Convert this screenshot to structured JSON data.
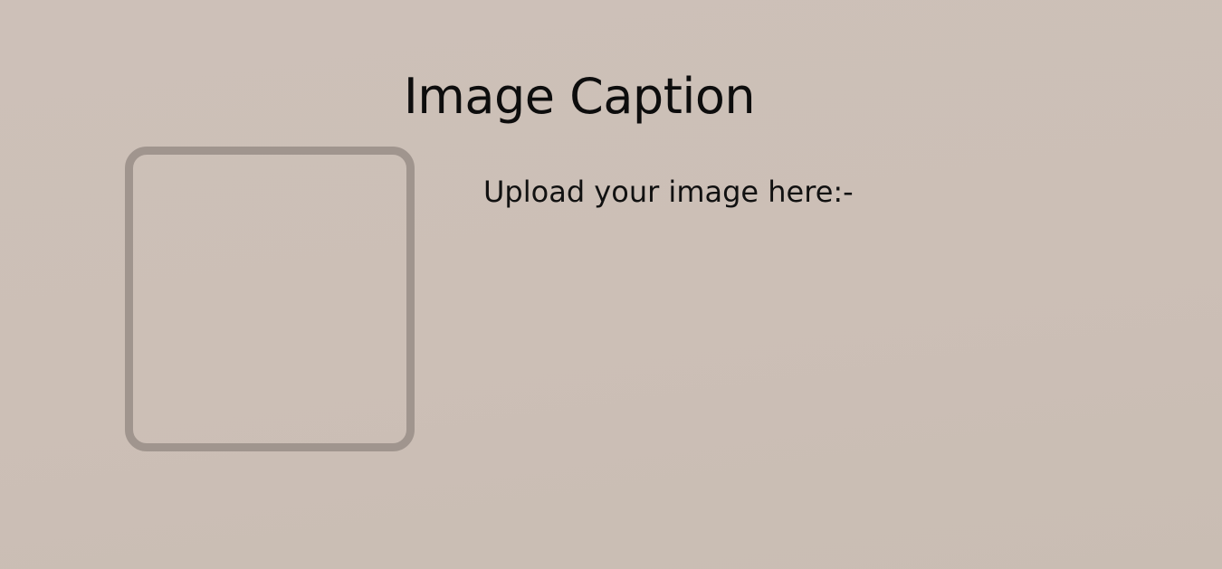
{
  "page": {
    "title": "Image Caption"
  },
  "upload": {
    "label": "Upload your image here:-"
  },
  "colors": {
    "background": "#ccbfb6",
    "dropzone_border": "#a0958e",
    "text": "#0e0e0e"
  }
}
